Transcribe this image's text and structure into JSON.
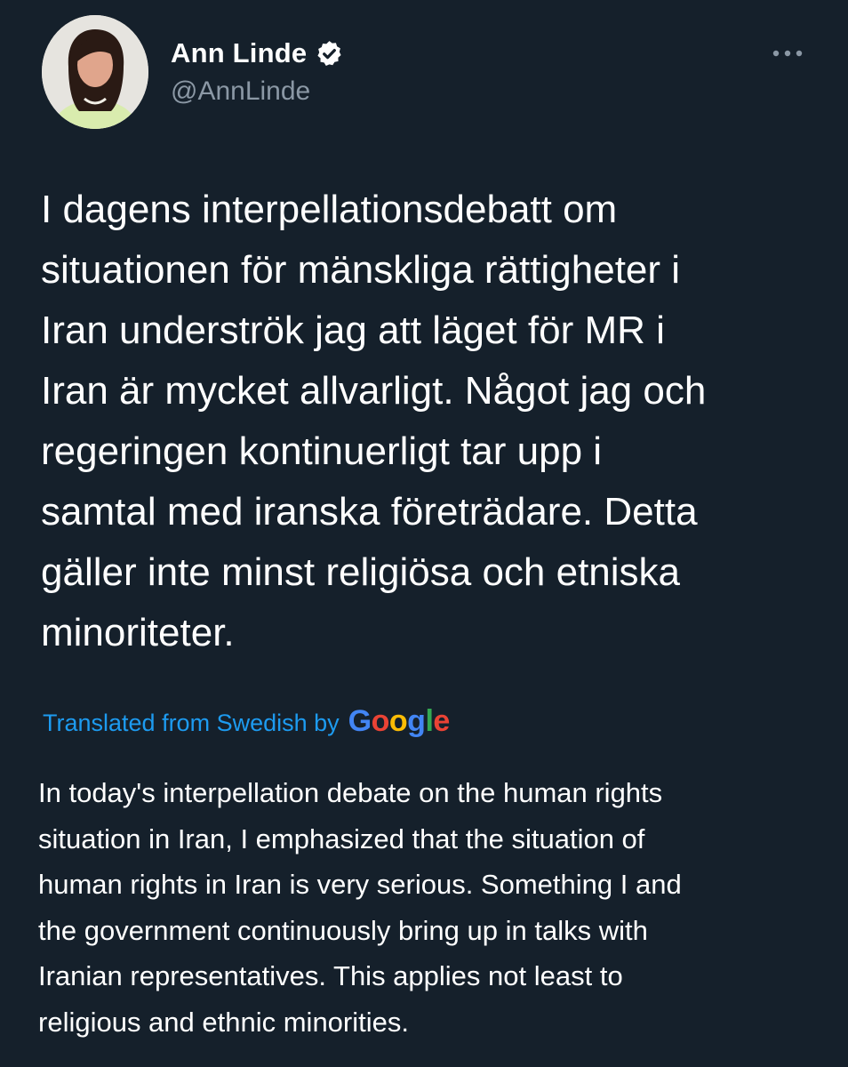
{
  "author": {
    "display_name": "Ann Linde",
    "handle": "@AnnLinde",
    "verified": true
  },
  "tweet": {
    "text": "I dagens interpellationsdebatt om\nsituationen för mänskliga rättigheter i\nIran underströk jag att läget för MR i\nIran är mycket allvarligt. Något jag och\nregeringen kontinuerligt tar upp i\nsamtal med iranska företrädare. Detta\ngäller inte minst religiösa och etniska\nminoriteter."
  },
  "translation": {
    "label": "Translated from Swedish by",
    "provider_letters": [
      "G",
      "o",
      "o",
      "g",
      "l",
      "e"
    ],
    "provider_colors": [
      "#4285f4",
      "#ea4335",
      "#fbbc05",
      "#4285f4",
      "#34a853",
      "#ea4335"
    ],
    "text": "In today's interpellation debate on the human rights\nsituation in Iran, I emphasized that the situation of\nhuman rights in Iran is very serious. Something I and\nthe government continuously bring up in talks with\nIranian representatives. This applies not least to\nreligious and ethnic minorities."
  },
  "icons": {
    "verified": "verified-badge-icon",
    "more": "more-dots-icon"
  },
  "colors": {
    "background": "#15202b",
    "text_primary": "#ffffff",
    "text_secondary": "#8b98a5",
    "accent": "#1d9bf0"
  }
}
